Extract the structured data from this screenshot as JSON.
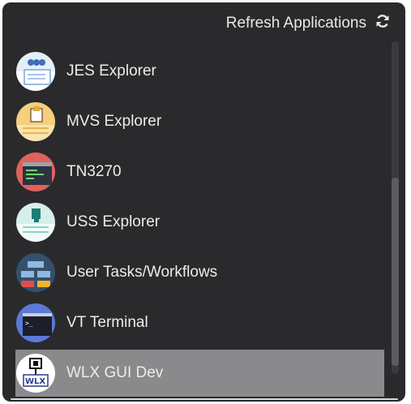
{
  "header": {
    "refresh_label": "Refresh Applications",
    "refresh_icon": "refresh-icon"
  },
  "apps": [
    {
      "label": "JES Explorer",
      "icon": "jes-explorer-icon",
      "color": "#dfeaf6"
    },
    {
      "label": "MVS Explorer",
      "icon": "mvs-explorer-icon",
      "color": "#f7d27e"
    },
    {
      "label": "TN3270",
      "icon": "tn3270-icon",
      "color": "#e0625a"
    },
    {
      "label": "USS Explorer",
      "icon": "uss-explorer-icon",
      "color": "#cfe9e5"
    },
    {
      "label": "User Tasks/Workflows",
      "icon": "workflows-icon",
      "color": "#3d5c7a"
    },
    {
      "label": "VT Terminal",
      "icon": "vt-terminal-icon",
      "color": "#5a79d6"
    },
    {
      "label": "WLX GUI Dev",
      "icon": "wlx-gui-dev-icon",
      "color": "#ffffff",
      "selected": true
    }
  ]
}
